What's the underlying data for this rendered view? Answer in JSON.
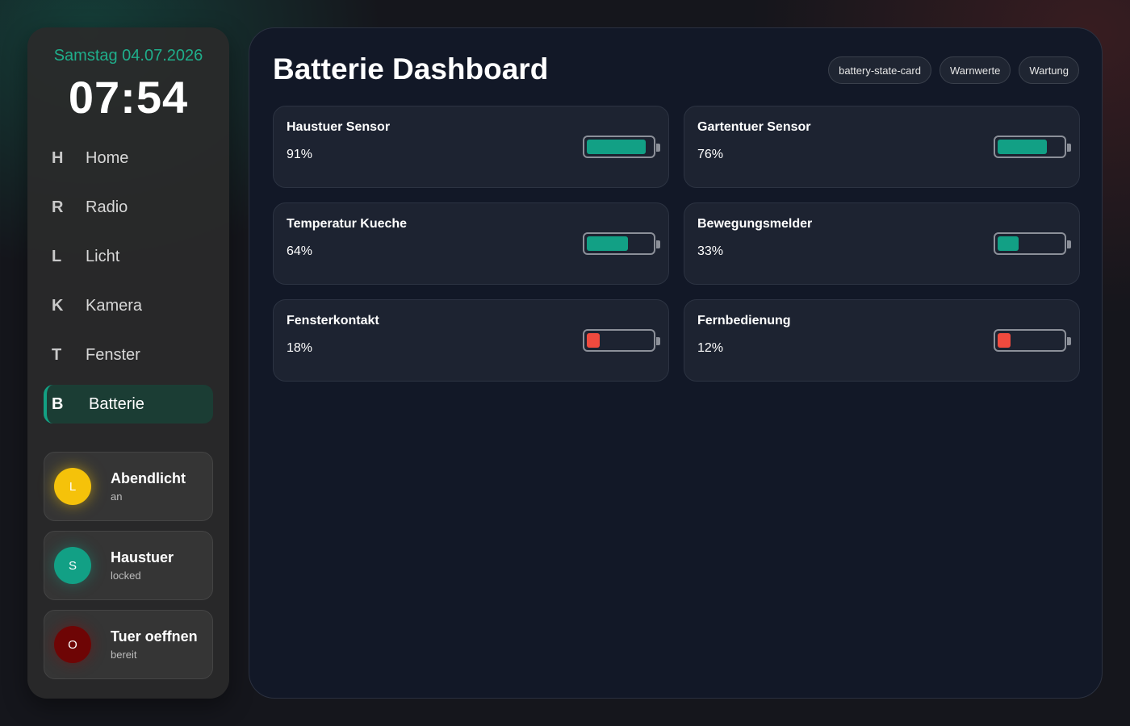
{
  "sidebar": {
    "date": "Samstag 04.07.2026",
    "time": "07:54",
    "nav": [
      {
        "key": "H",
        "label": "Home"
      },
      {
        "key": "R",
        "label": "Radio"
      },
      {
        "key": "L",
        "label": "Licht"
      },
      {
        "key": "K",
        "label": "Kamera"
      },
      {
        "key": "T",
        "label": "Fenster"
      },
      {
        "key": "B",
        "label": "Batterie",
        "active": true
      }
    ],
    "tiles": [
      {
        "initial": "L",
        "name": "Abendlicht",
        "state": "an",
        "color": "#f5c20a"
      },
      {
        "initial": "S",
        "name": "Haustuer",
        "state": "locked",
        "color": "#12a085"
      },
      {
        "initial": "O",
        "name": "Tuer oeffnen",
        "state": "bereit",
        "color": "#6e0505"
      }
    ]
  },
  "main": {
    "title": "Batterie Dashboard",
    "chips": [
      "battery-state-card",
      "Warnwerte",
      "Wartung"
    ],
    "cards": [
      {
        "name": "Haustuer Sensor",
        "percent_label": "91%",
        "level": 91
      },
      {
        "name": "Gartentuer Sensor",
        "percent_label": "76%",
        "level": 76
      },
      {
        "name": "Temperatur Kueche",
        "percent_label": "64%",
        "level": 64
      },
      {
        "name": "Bewegungsmelder",
        "percent_label": "33%",
        "level": 33
      },
      {
        "name": "Fensterkontakt",
        "percent_label": "18%",
        "level": 18
      },
      {
        "name": "Fernbedienung",
        "percent_label": "12%",
        "level": 12
      }
    ]
  },
  "colors": {
    "accent": "#13a083",
    "battery_ok": "#12a085",
    "battery_low": "#f04a3e"
  }
}
